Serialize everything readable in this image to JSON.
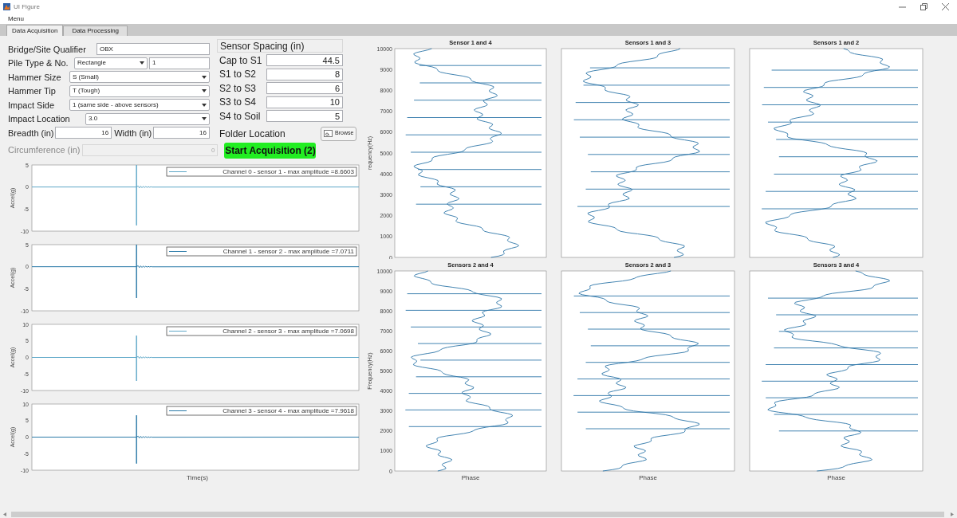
{
  "window": {
    "title": "UI Figure"
  },
  "menu": [
    "Menu"
  ],
  "tabs": [
    {
      "label": "Data Acquisition",
      "selected": true
    },
    {
      "label": "Data Processing",
      "selected": false
    }
  ],
  "form": {
    "fields": [
      {
        "kind": "text",
        "label": "Bridge/Site Qualifier",
        "value": "OBX"
      },
      {
        "kind": "select_text",
        "label": "Pile Type & No.",
        "value": "Rectangle",
        "value2": "1"
      },
      {
        "kind": "select",
        "label": "Hammer Size",
        "value": "S (Small)"
      },
      {
        "kind": "select",
        "label": "Hammer Tip",
        "value": "T (Tough)"
      },
      {
        "kind": "select",
        "label": "Impact Side",
        "value": "1 (same side - above sensors)"
      },
      {
        "kind": "select",
        "label": "Impact Location",
        "value": "3.0"
      },
      {
        "kind": "pair",
        "label": "Breadth (in)",
        "value": "16",
        "label2": "Width (in)",
        "value2": "16"
      }
    ],
    "circumference": {
      "label": "Circumference (in)",
      "value": "0",
      "disabled": true
    }
  },
  "sensor_spacing": {
    "title": "Sensor Spacing (in)",
    "rows": [
      {
        "label": "Cap to S1",
        "value": "44.5"
      },
      {
        "label": "S1 to S2",
        "value": "8"
      },
      {
        "label": "S2 to S3",
        "value": "6"
      },
      {
        "label": "S3 to S4",
        "value": "10"
      },
      {
        "label": "S4 to Soil",
        "value": "5"
      }
    ]
  },
  "folder": {
    "label": "Folder Location",
    "browse": "Browse"
  },
  "start_button": "Start Acquisition (2)",
  "time_plots": {
    "xlabel": "Time(s)",
    "plots": [
      {
        "ylabel": "Accel(g)",
        "yticks": [
          "5",
          "0",
          "-5",
          "-10"
        ],
        "legend": "Channel 0 - sensor 1 - max amplitude =8.6603",
        "color": "#5fa8c8"
      },
      {
        "ylabel": "Accel(g)",
        "yticks": [
          "5",
          "0",
          "-5",
          "-10"
        ],
        "legend": "Channel 1 - sensor 2 - max amplitude =7.0711",
        "color": "#2a7aa8"
      },
      {
        "ylabel": "Accel(g)",
        "yticks": [
          "10",
          "5",
          "0",
          "-5",
          "-10"
        ],
        "legend": "Channel 2 - sensor 3 - max amplitude =7.0698",
        "color": "#5fa8c8"
      },
      {
        "ylabel": "Accel(g)",
        "yticks": [
          "10",
          "5",
          "0",
          "-5",
          "-10"
        ],
        "legend": "Channel 3 - sensor 4 - max amplitude =7.9618",
        "color": "#2a7aa8"
      }
    ]
  },
  "phase_plots": {
    "rows": [
      [
        {
          "title": "Sensor 1 and 4",
          "ylabel": "requency(Hz)",
          "yticks": [
            "10000",
            "9000",
            "8000",
            "7000",
            "6000",
            "5000",
            "4000",
            "3000",
            "2000",
            "1000",
            "0"
          ]
        },
        {
          "title": "Sensors 1 and 3"
        },
        {
          "title": "Sensors 1 and 2"
        }
      ],
      [
        {
          "title": "Sensors 2 and 4",
          "ylabel": "Frequency(Hz)",
          "yticks": [
            "10000",
            "9000",
            "8000",
            "7000",
            "6000",
            "5000",
            "4000",
            "3000",
            "2000",
            "1000",
            "0"
          ],
          "xlabel": "Phase"
        },
        {
          "title": "Sensors 2 and 3",
          "xlabel": "Phase"
        },
        {
          "title": "Sensors 3 and 4",
          "xlabel": "Phase"
        }
      ]
    ]
  }
}
